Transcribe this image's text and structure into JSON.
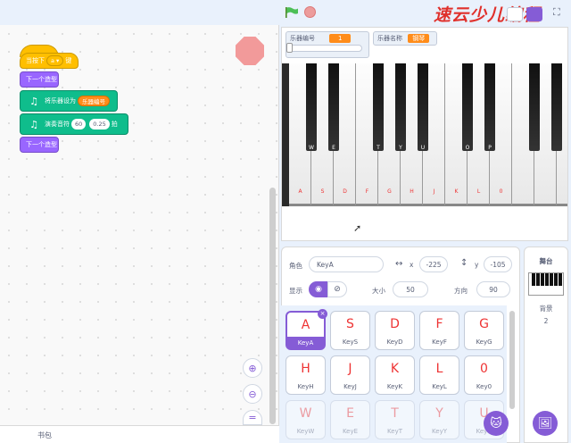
{
  "toolbar": {
    "brand": "速云少儿编程"
  },
  "code": {
    "hat": {
      "label_prefix": "当按下",
      "key": "a ▾",
      "label_suffix": "键"
    },
    "next_costume_1": "下一个造型",
    "set_instrument": {
      "label": "将乐器设为",
      "value": "乐器编号"
    },
    "play_note": {
      "label": "演奏音符",
      "note": "60",
      "beats": "0.25",
      "suffix": "拍"
    },
    "next_costume_2": "下一个造型",
    "zoom_in_icon": "zoom-in",
    "zoom_out_icon": "zoom-out",
    "backpack": "书包"
  },
  "stage": {
    "monitor_instrument_id": {
      "label": "乐器编号",
      "value": "1"
    },
    "monitor_instrument_name": {
      "label": "乐器名称",
      "value": "钢琴"
    },
    "black_keys": [
      "W",
      "E",
      "T",
      "Y",
      "U",
      "O",
      "P"
    ],
    "white_keys": [
      "A",
      "S",
      "D",
      "F",
      "G",
      "H",
      "J",
      "K",
      "L",
      "0"
    ]
  },
  "sprite_info": {
    "sprite_label": "角色",
    "sprite_name": "KeyA",
    "x_label": "x",
    "x_value": "-225",
    "y_label": "y",
    "y_value": "-105",
    "show_label": "显示",
    "size_label": "大小",
    "size_value": "50",
    "direction_label": "方向",
    "direction_value": "90"
  },
  "sprites": [
    {
      "glyph": "A",
      "name": "KeyA",
      "selected": true
    },
    {
      "glyph": "S",
      "name": "KeyS"
    },
    {
      "glyph": "D",
      "name": "KeyD"
    },
    {
      "glyph": "F",
      "name": "KeyF"
    },
    {
      "glyph": "G",
      "name": "KeyG"
    },
    {
      "glyph": "H",
      "name": "KeyH"
    },
    {
      "glyph": "J",
      "name": "KeyJ"
    },
    {
      "glyph": "K",
      "name": "KeyK"
    },
    {
      "glyph": "L",
      "name": "KeyL"
    },
    {
      "glyph": "0",
      "name": "Key0"
    },
    {
      "glyph": "W",
      "name": "KeyW"
    },
    {
      "glyph": "E",
      "name": "KeyE"
    },
    {
      "glyph": "T",
      "name": "KeyT"
    },
    {
      "glyph": "Y",
      "name": "KeyY"
    },
    {
      "glyph": "U",
      "name": "KeyU"
    }
  ],
  "stage_selector": {
    "title": "舞台",
    "backdrop_label": "背景",
    "backdrop_count": "2"
  },
  "colors": {
    "accent": "#855cd6",
    "event": "#ffbf00",
    "looks": "#9966ff",
    "music": "#0fbd8c",
    "key_label": "#e33333"
  }
}
